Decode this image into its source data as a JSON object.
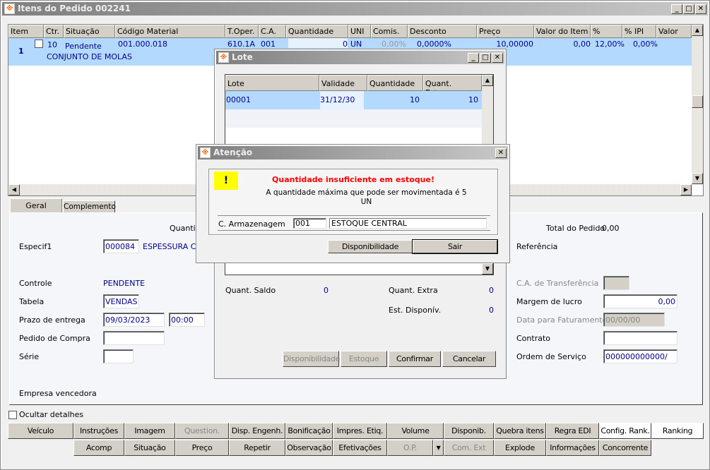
{
  "main": {
    "title": "Itens do Pedido 002241",
    "grid": {
      "columns": [
        "Item",
        "Ctr.",
        "Situação",
        "Código Material",
        "T.Oper.",
        "C.A.",
        "Quantidade",
        "UNI",
        "Comis.",
        "Desconto",
        "Preço Unitário",
        "Valor do Item",
        "% ICMS",
        "% IPI",
        "Valor IPI"
      ],
      "row": {
        "item": "1",
        "ctr": "10",
        "situacao": "Pendente",
        "codigo": "001.000.018",
        "descricao": "CONJUNTO DE MOLAS",
        "toper": "610.1A",
        "ca": "001",
        "quantidade": "0",
        "uni": "UN",
        "comis": "0,00%",
        "desconto": "0,0000%",
        "preco": "10,00000",
        "valor": "0,00",
        "icms": "12,00%",
        "ipi": "0,00%",
        "valor_ipi": ""
      }
    },
    "tabs": [
      "Geral",
      "Complemento"
    ],
    "geral": {
      "quantid": "Quantid",
      "especif1_label": "Especif1",
      "especif1_code": "000084",
      "especif1_desc": "ESPESSURA CO",
      "controle_label": "Controle",
      "controle_value": "PENDENTE",
      "tabela_label": "Tabela",
      "tabela_value": "VENDAS",
      "prazo_label": "Prazo de entrega",
      "prazo_date": "09/03/2023",
      "prazo_time": "00:00",
      "pedido_compra_label": "Pedido de Compra",
      "pedido_compra_value": "",
      "serie_label": "Série",
      "serie_value": "",
      "empresa_label": "Empresa vencedora",
      "total_label": "Total do Pedido",
      "total_value": "0,00",
      "referencia_label": "Referência",
      "ca_transf_label": "C.A. de Transferência",
      "margem_label": "Margem de lucro",
      "margem_value": "0,00",
      "data_fat_label": "Data para Faturamento",
      "data_fat_value": "00/00/00",
      "contrato_label": "Contrato",
      "contrato_value": "",
      "os_label": "Ordem de Serviço",
      "os_value": "000000000000/"
    },
    "ocultar_label": "Ocultar detalhes",
    "buttons_row1": [
      "Veículo",
      "Instruções",
      "Imagem",
      "Question.",
      "Disp. Engenh.",
      "Bonificação",
      "Impres. Etiq.",
      "Volume",
      "Disponib.",
      "Quebra itens",
      "Regra EDI",
      "Config. Rank.",
      "Ranking"
    ],
    "buttons_row2": [
      "Acomp",
      "Situação",
      "Preço",
      "Repetir",
      "Observação",
      "Efetivações",
      "O.P.",
      "Com. Ext",
      "Explode",
      "Informações",
      "Concorrente"
    ]
  },
  "lote": {
    "title": "Lote",
    "columns": [
      "Lote",
      "Validade",
      "Quantidade",
      "Quant. Estoque"
    ],
    "row": {
      "lote": "00001",
      "validade": "31/12/30",
      "quantidade": "10",
      "estoque": "10"
    },
    "saldo_label": "Quant. Saldo",
    "saldo_value": "0",
    "extra_label": "Quant. Extra",
    "extra_value": "0",
    "disp_label": "Est. Disponív.",
    "disp_value": "0",
    "buttons": [
      "Disponibilidade",
      "Estoque",
      "Confirmar",
      "Cancelar"
    ]
  },
  "atencao": {
    "title": "Atenção",
    "icon": "!",
    "headline": "Quantidade insuficiente em estoque!",
    "message": "A quantidade máxima que pode ser movimentada é 5",
    "unit": "UN",
    "armazenagem_label": "C. Armazenagem",
    "armazenagem_code": "001",
    "armazenagem_desc": "ESTOQUE CENTRAL",
    "buttons": [
      "Disponibilidade",
      "Sair"
    ],
    "headline_color": "#ff0000"
  }
}
